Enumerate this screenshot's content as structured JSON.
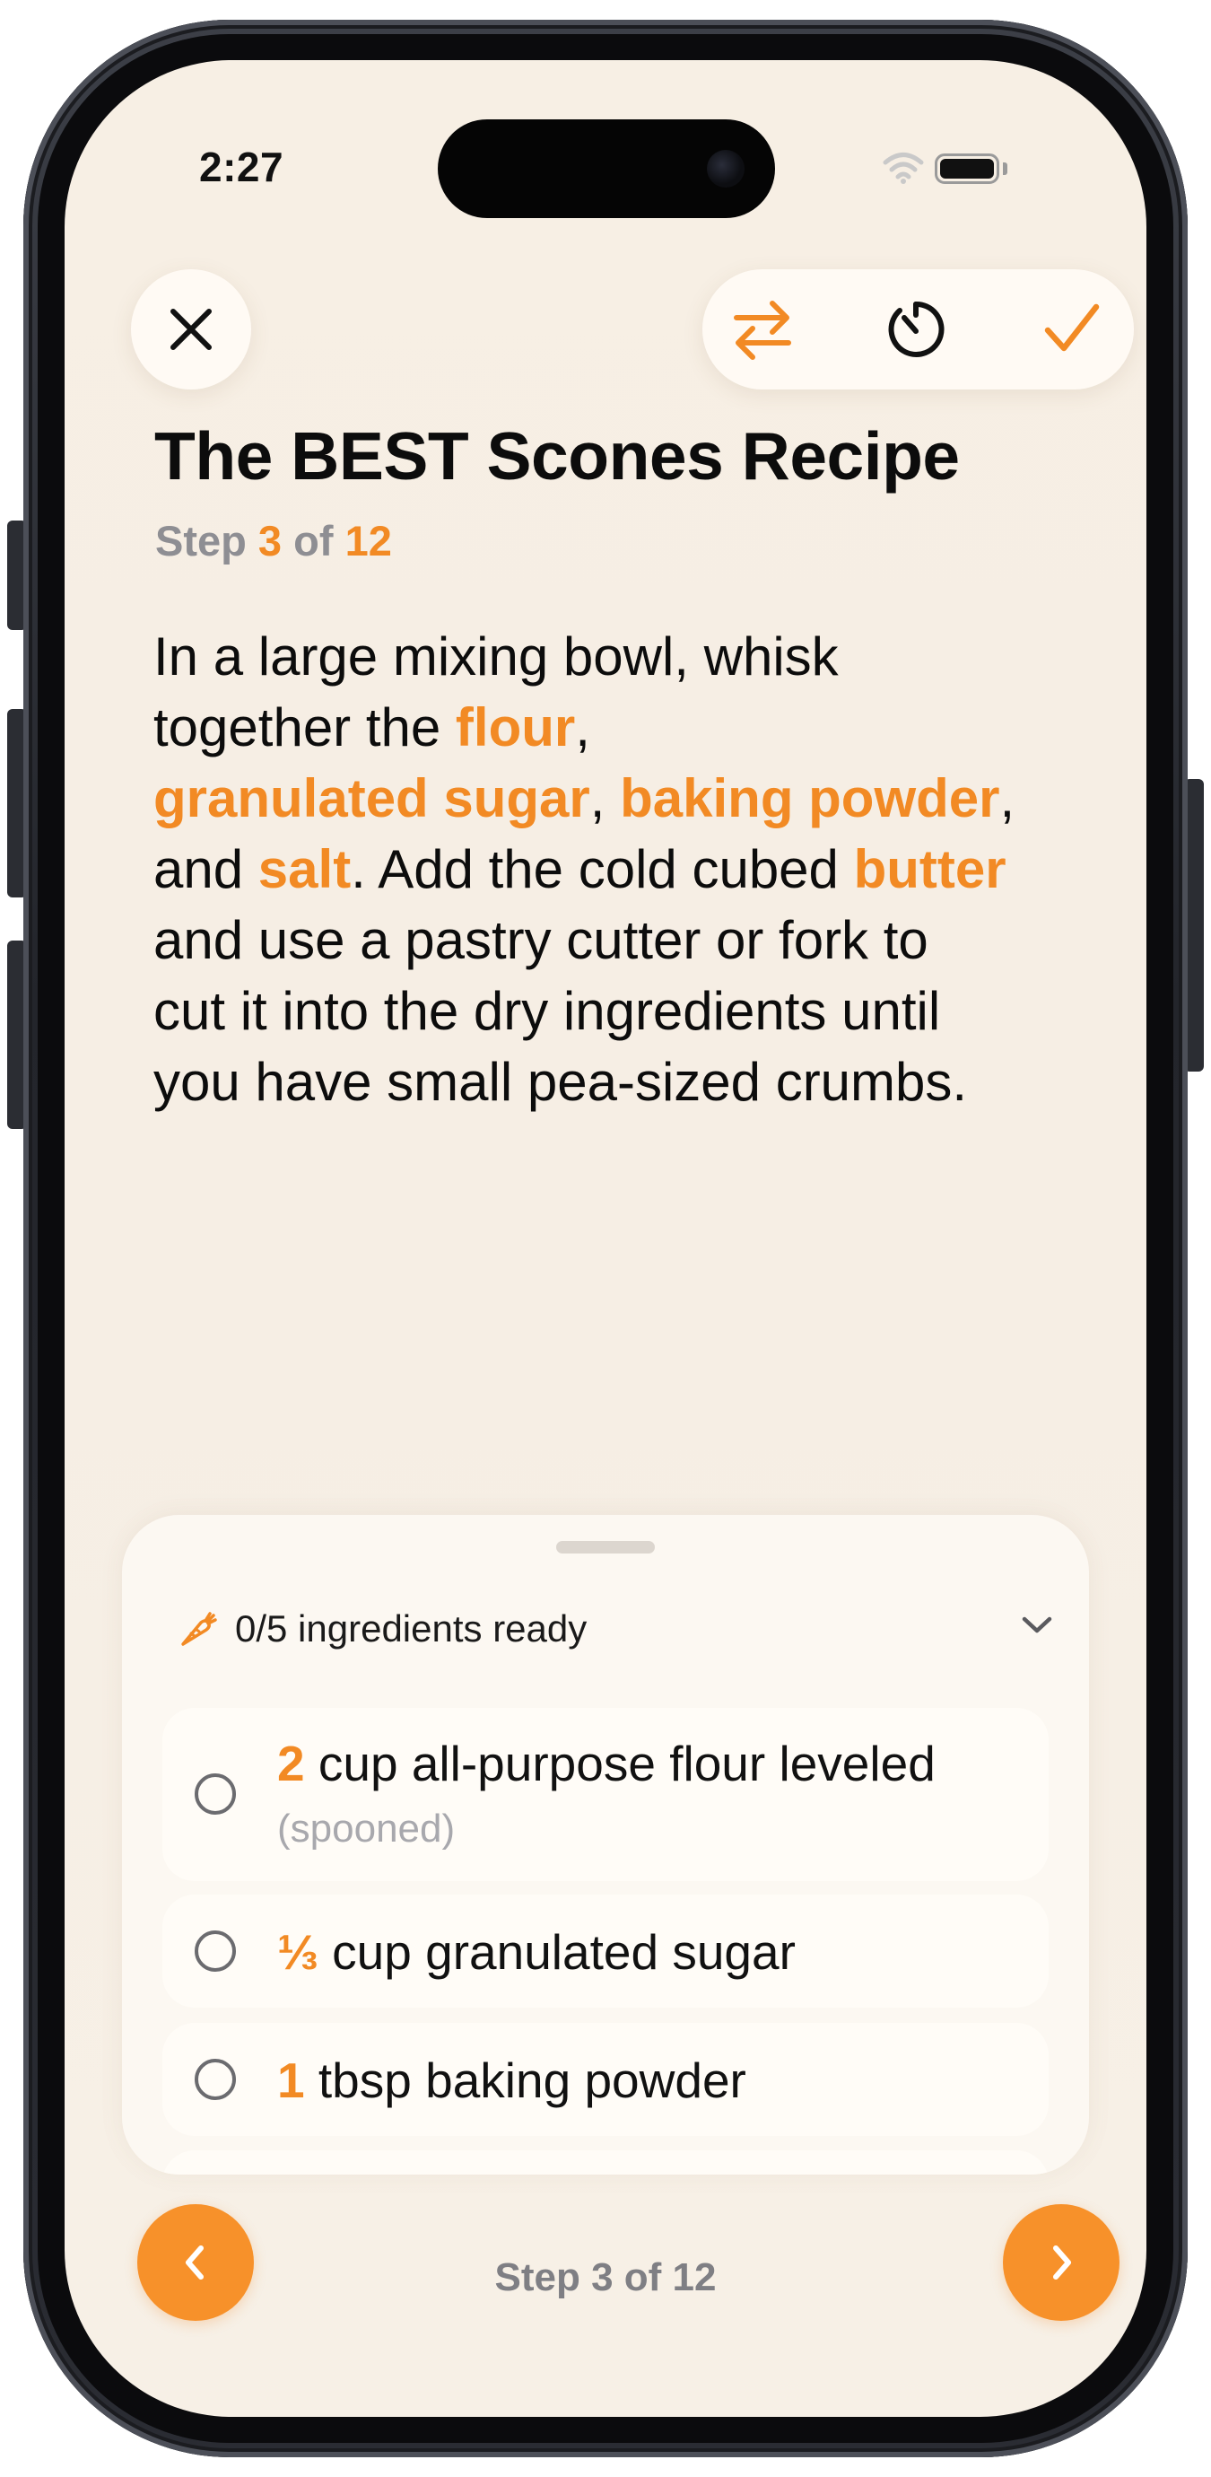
{
  "status_bar": {
    "time": "2:27"
  },
  "toolbar": {
    "close_icon": "close-icon",
    "swap_icon": "swap-arrows-icon",
    "timer_icon": "timer-icon",
    "done_icon": "checkmark-icon"
  },
  "recipe": {
    "title": "The BEST Scones Recipe",
    "step_label": "Step",
    "step_current": "3",
    "step_of": "of",
    "step_total": "12"
  },
  "instruction": {
    "line1": "In a large mixing bowl, whisk",
    "line2_a": "together the ",
    "line2_ing": "flour",
    "line2_b": ",",
    "line3_ing1": "granulated sugar",
    "line3_a": ", ",
    "line3_ing2": "baking powder",
    "line3_b": ",",
    "line4_a": "and ",
    "line4_ing1": "salt",
    "line4_b": ". Add the cold cubed ",
    "line4_ing2": "butter",
    "line5": "and use a pastry cutter or fork to",
    "line6": "cut it into the dry ingredients until",
    "line7": "you have small pea-sized crumbs."
  },
  "ingredients_panel": {
    "header_icon": "carrot-icon",
    "header": "0/5 ingredients ready",
    "items": [
      {
        "qty": "2",
        "text": " cup all-purpose flour leveled",
        "note": "(spooned)",
        "checked": false
      },
      {
        "qty": "⅓",
        "text": " cup granulated sugar",
        "checked": false
      },
      {
        "qty": "1",
        "text": " tbsp baking powder",
        "checked": false
      }
    ]
  },
  "footer": {
    "step_text": "Step 3 of 12",
    "prev_icon": "chevron-left-icon",
    "next_icon": "chevron-right-icon"
  },
  "colors": {
    "accent": "#F28A24",
    "background": "#F7EFE4",
    "text": "#0C0C0C",
    "secondary_text": "#8E8E93"
  }
}
